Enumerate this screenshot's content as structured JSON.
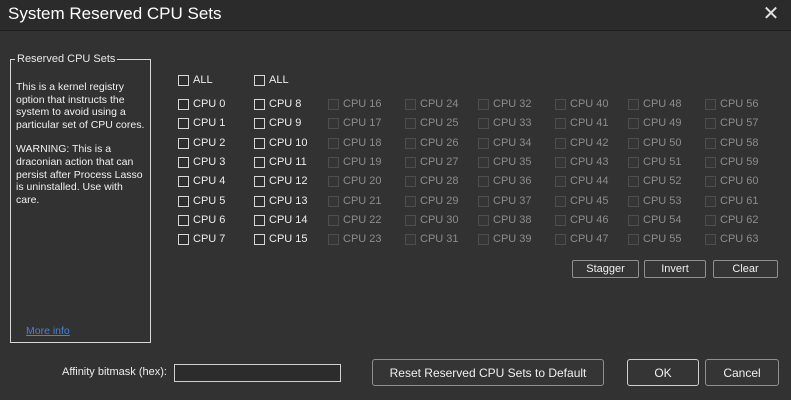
{
  "window": {
    "title": "System Reserved CPU Sets",
    "close_glyph": "✕"
  },
  "reserved_panel": {
    "legend": "Reserved CPU Sets",
    "description": "This is a kernel registry option that instructs the system to avoid using a particular set of CPU cores.",
    "warning": "WARNING: This is a draconian action that can persist after Process Lasso is uninstalled. Use with care.",
    "more_info_link": "More info"
  },
  "columns": [
    {
      "all_label": "ALL",
      "enabled": true,
      "cpus": [
        "CPU 0",
        "CPU 1",
        "CPU 2",
        "CPU 3",
        "CPU 4",
        "CPU 5",
        "CPU 6",
        "CPU 7"
      ]
    },
    {
      "all_label": "ALL",
      "enabled": true,
      "cpus": [
        "CPU 8",
        "CPU 9",
        "CPU 10",
        "CPU 11",
        "CPU 12",
        "CPU 13",
        "CPU 14",
        "CPU 15"
      ]
    },
    {
      "all_label": "",
      "enabled": false,
      "cpus": [
        "CPU 16",
        "CPU 17",
        "CPU 18",
        "CPU 19",
        "CPU 20",
        "CPU 21",
        "CPU 22",
        "CPU 23"
      ]
    },
    {
      "all_label": "",
      "enabled": false,
      "cpus": [
        "CPU 24",
        "CPU 25",
        "CPU 26",
        "CPU 27",
        "CPU 28",
        "CPU 29",
        "CPU 30",
        "CPU 31"
      ]
    },
    {
      "all_label": "",
      "enabled": false,
      "cpus": [
        "CPU 32",
        "CPU 33",
        "CPU 34",
        "CPU 35",
        "CPU 36",
        "CPU 37",
        "CPU 38",
        "CPU 39"
      ]
    },
    {
      "all_label": "",
      "enabled": false,
      "cpus": [
        "CPU 40",
        "CPU 41",
        "CPU 42",
        "CPU 43",
        "CPU 44",
        "CPU 45",
        "CPU 46",
        "CPU 47"
      ]
    },
    {
      "all_label": "",
      "enabled": false,
      "cpus": [
        "CPU 48",
        "CPU 49",
        "CPU 50",
        "CPU 51",
        "CPU 52",
        "CPU 53",
        "CPU 54",
        "CPU 55"
      ]
    },
    {
      "all_label": "",
      "enabled": false,
      "cpus": [
        "CPU 56",
        "CPU 57",
        "CPU 58",
        "CPU 59",
        "CPU 60",
        "CPU 61",
        "CPU 62",
        "CPU 63"
      ]
    }
  ],
  "actions": {
    "stagger": "Stagger",
    "invert": "Invert",
    "clear": "Clear"
  },
  "footer": {
    "affinity_label": "Affinity bitmask (hex):",
    "affinity_value": "",
    "reset_button": "Reset Reserved CPU Sets to Default",
    "ok_button": "OK",
    "cancel_button": "Cancel"
  },
  "colors": {
    "background": "#323232",
    "titlebar": "#2b2b2b",
    "link": "#4a7fd8",
    "disabled_text": "#8c8c8c"
  }
}
